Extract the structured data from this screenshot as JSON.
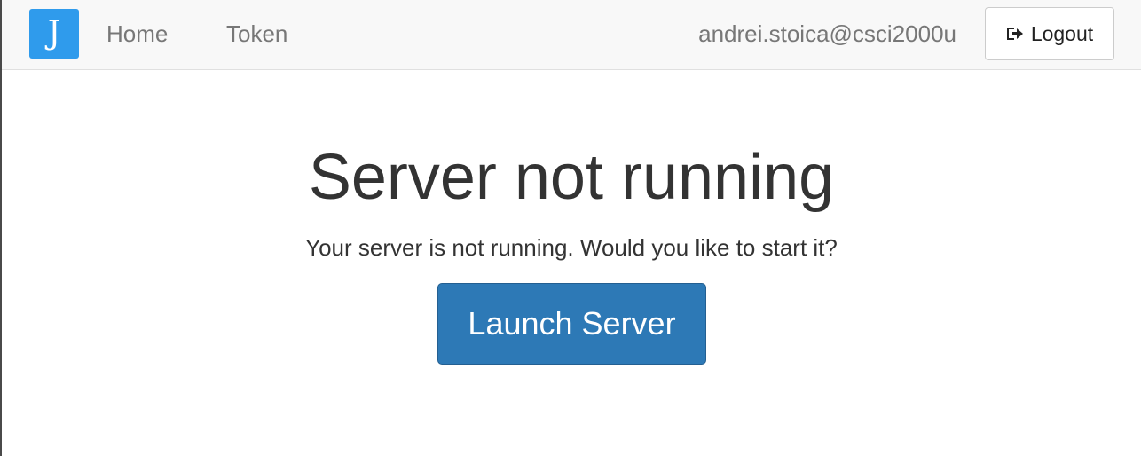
{
  "header": {
    "logo_letter": "J",
    "nav": {
      "home_label": "Home",
      "token_label": "Token"
    },
    "user": "andrei.stoica@csci2000u",
    "logout_label": "Logout"
  },
  "main": {
    "title": "Server not running",
    "message": "Your server is not running. Would you like to start it?",
    "launch_label": "Launch Server"
  },
  "colors": {
    "logo_bg": "#2f9bec",
    "primary_button": "#2d79b6",
    "navbar_bg": "#f8f8f8",
    "nav_text": "#777777"
  }
}
